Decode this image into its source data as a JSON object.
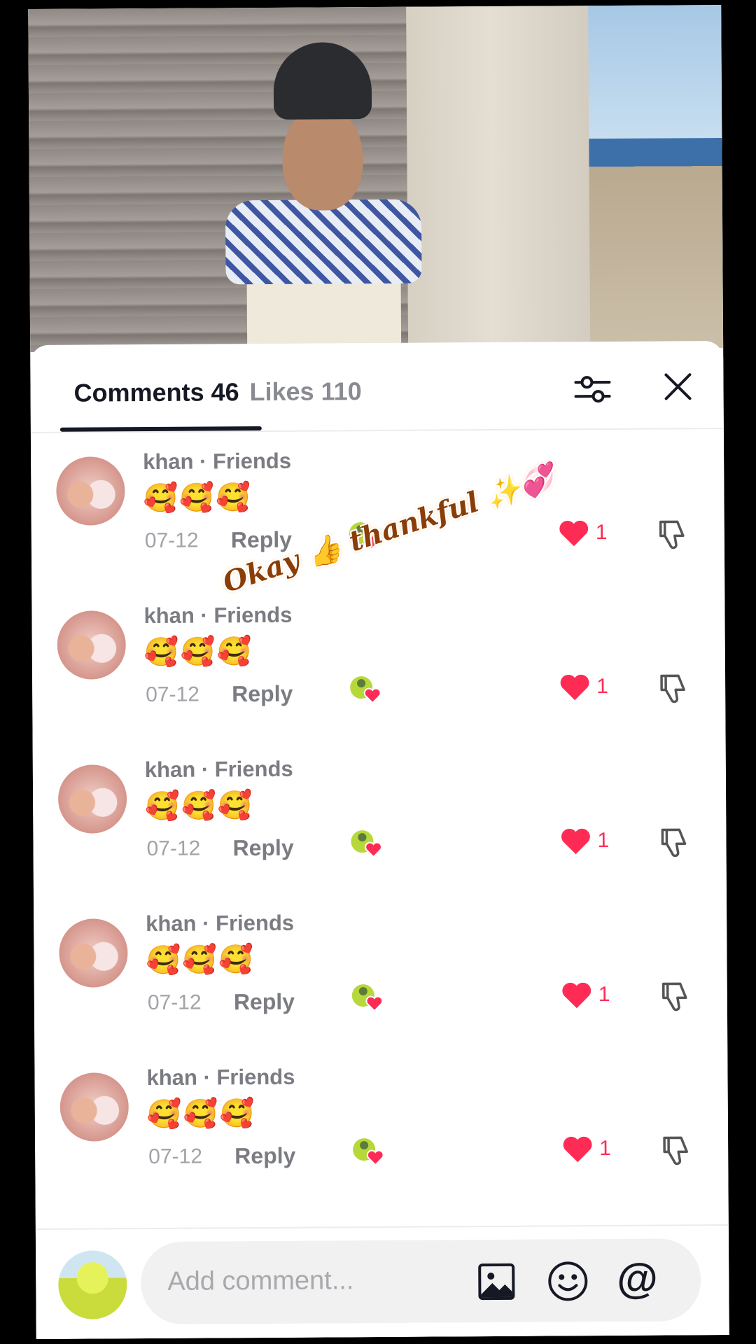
{
  "tabs": {
    "comments_label": "Comments 46",
    "likes_label": "Likes 110"
  },
  "comments": [
    {
      "author": "khan · Friends",
      "text": "🥰🥰🥰",
      "date": "07-12",
      "reply": "Reply",
      "likes": "1"
    },
    {
      "author": "khan · Friends",
      "text": "🥰🥰🥰",
      "date": "07-12",
      "reply": "Reply",
      "likes": "1"
    },
    {
      "author": "khan · Friends",
      "text": "🥰🥰🥰",
      "date": "07-12",
      "reply": "Reply",
      "likes": "1"
    },
    {
      "author": "khan · Friends",
      "text": "🥰🥰🥰",
      "date": "07-12",
      "reply": "Reply",
      "likes": "1"
    },
    {
      "author": "khan · Friends",
      "text": "🥰🥰🥰",
      "date": "07-12",
      "reply": "Reply",
      "likes": "1"
    }
  ],
  "sticker": "Okay 👍 thankful ✨💞",
  "input": {
    "placeholder": "Add comment...",
    "at_symbol": "@"
  },
  "icons": {
    "filter": "sliders-icon",
    "close": "close-icon",
    "like": "heart-icon",
    "dislike": "thumbs-down-icon",
    "image": "image-icon",
    "emoji": "emoji-icon"
  },
  "colors": {
    "like": "#fe2c55",
    "text_primary": "#161823",
    "text_secondary": "#7b7c82"
  }
}
